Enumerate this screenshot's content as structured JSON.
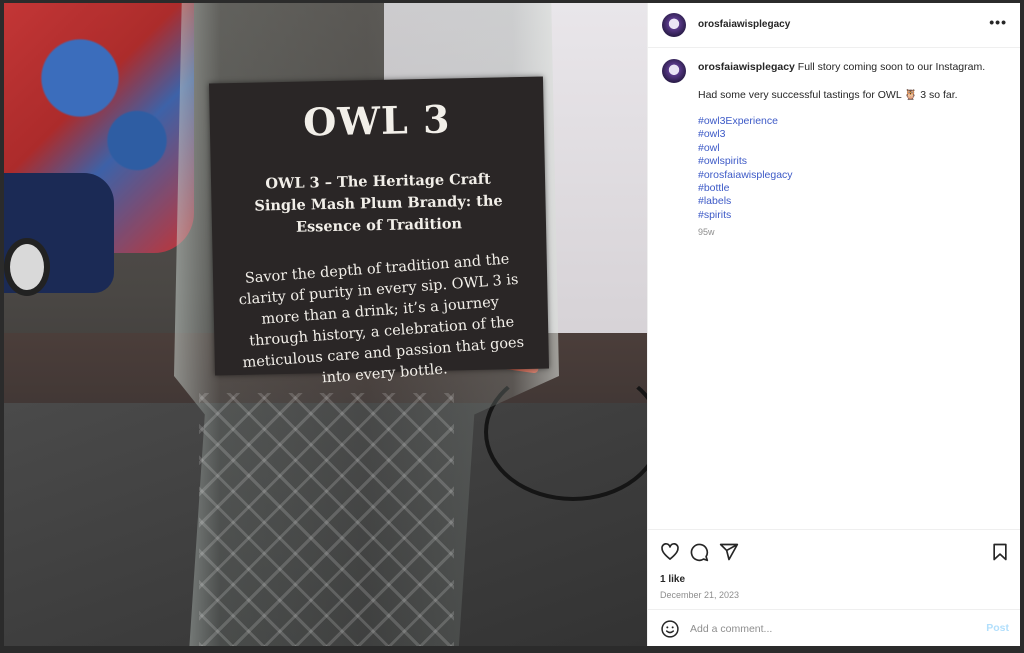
{
  "post": {
    "username": "orosfaiawisplegacy",
    "more_icon": "more-horizontal-icon"
  },
  "photo": {
    "label_title": "OWL 3",
    "label_subtitle_1": "OWL 3 – The Heritage Craft",
    "label_subtitle_2": "Single Mash Plum Brandy: the Essence of Tradition",
    "label_body": "Savor the depth of tradition and the clarity of purity in every sip. OWL 3 is more than a drink; it’s a journey through history, a celebration of the meticulous care and passion that goes into every bottle."
  },
  "caption": {
    "username": "orosfaiawisplegacy",
    "line1": "Full story coming soon to our Instagram.",
    "line2_prefix": "Had some very successful tastings for OWL",
    "line2_emoji": "🦉",
    "line2_suffix": "3 so far.",
    "hashtags": [
      "#owl3Experience",
      "#owl3",
      "#owl",
      "#owlspirits",
      "#orosfaiawisplegacy",
      "#bottle",
      "#labels",
      "#spirits"
    ],
    "age": "95w"
  },
  "actions": {
    "likes": "1 like",
    "date": "December 21, 2023"
  },
  "comment": {
    "placeholder": "Add a comment...",
    "post_label": "Post"
  },
  "colors": {
    "link": "#3d5ac7",
    "post_button_disabled": "#b2dffc",
    "muted": "#8e8e8e"
  }
}
